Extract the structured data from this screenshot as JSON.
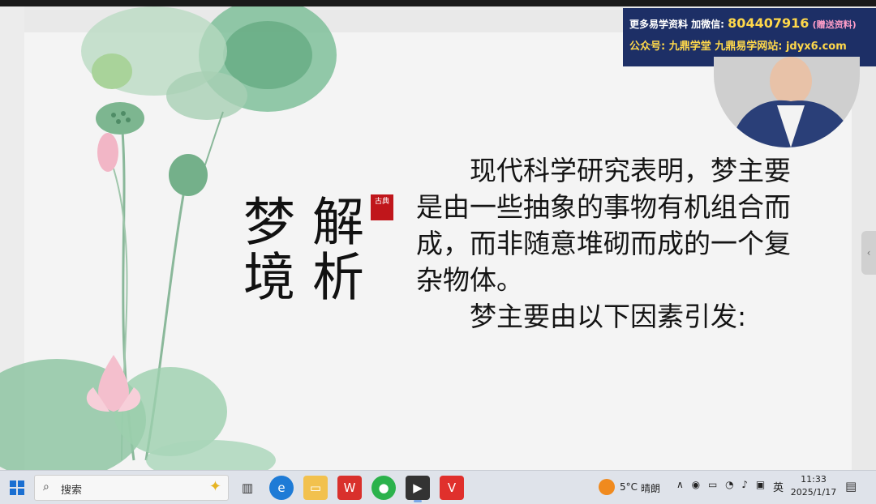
{
  "slide": {
    "title_col1": "解析",
    "title_col2": "梦境",
    "seal_text": "古典",
    "paragraphs": [
      "　　现代科学研究表明，梦主要是由一些抽象的事物有机组合而成，而非随意堆砌而成的一个复杂物体。",
      "　　梦主要由以下因素引发:"
    ]
  },
  "overlay": {
    "line1_prefix": "更多易学资料 加微信:",
    "line1_number": "804407916",
    "line1_suffix": "(赠送资料)",
    "line2": "公众号: 九鼎学堂 九鼎易学网站: jdyx6.com"
  },
  "taskbar": {
    "search_placeholder": "搜索",
    "weather_temp": "5°C",
    "weather_desc": "晴朗",
    "ime": "英",
    "time": "11:33",
    "date": "2025/1/17"
  },
  "colors": {
    "seal": "#c0161b",
    "banner_bg": "#1d2f66",
    "banner_highlight": "#ffd84a"
  }
}
